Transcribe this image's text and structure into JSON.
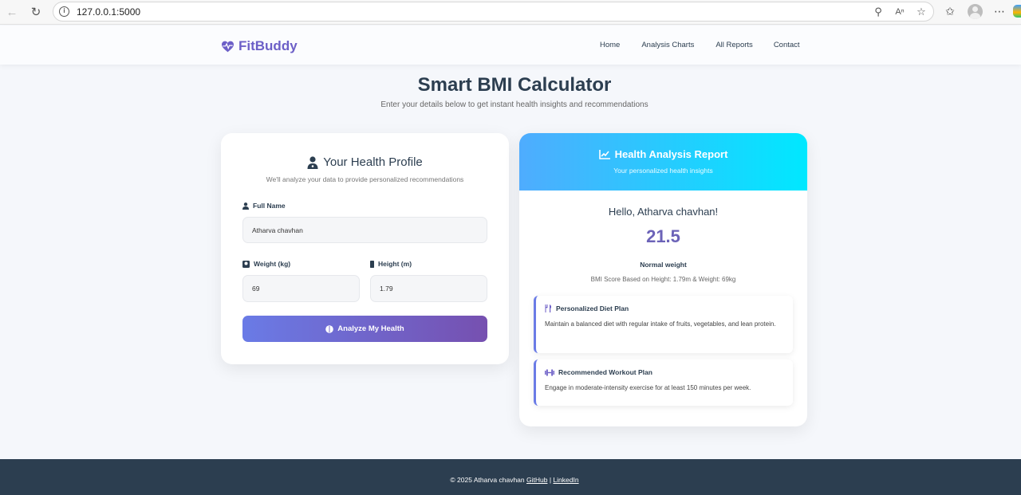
{
  "browser": {
    "url": "127.0.0.1:5000"
  },
  "nav": {
    "brand": "FitBuddy",
    "links": [
      "Home",
      "Analysis Charts",
      "All Reports",
      "Contact"
    ]
  },
  "header": {
    "title": "Smart BMI Calculator",
    "subtitle": "Enter your details below to get instant health insights and recommendations"
  },
  "form": {
    "title": "Your Health Profile",
    "subtitle": "We'll analyze your data to provide personalized recommendations",
    "name_label": "Full Name",
    "name_value": "Atharva chavhan",
    "weight_label": "Weight (kg)",
    "weight_value": "69",
    "height_label": "Height (m)",
    "height_value": "1.79",
    "submit_label": "Analyze My Health"
  },
  "report": {
    "title": "Health Analysis Report",
    "subtitle": "Your personalized health insights",
    "greeting": "Hello, Atharva chavhan!",
    "bmi": "21.5",
    "category": "Normal weight",
    "note": "BMI Score Based on Height: 1.79m & Weight: 69kg",
    "diet_title": "Personalized Diet Plan",
    "diet_text": "Maintain a balanced diet with regular intake of fruits, vegetables, and lean protein.",
    "workout_title": "Recommended Workout Plan",
    "workout_text": "Engage in moderate-intensity exercise for at least 150 minutes per week."
  },
  "footer": {
    "copyright": "© 2025 Atharva chavhan",
    "github": "GitHub",
    "separator": "|",
    "linkedin": "LinkedIn"
  },
  "colors": {
    "brand": "#6c5fc7",
    "report_gradient_start": "#4facfe",
    "report_gradient_end": "#00e8ff",
    "button_gradient_start": "#6a7be6",
    "button_gradient_end": "#7650b0",
    "footer": "#2c3e50"
  }
}
